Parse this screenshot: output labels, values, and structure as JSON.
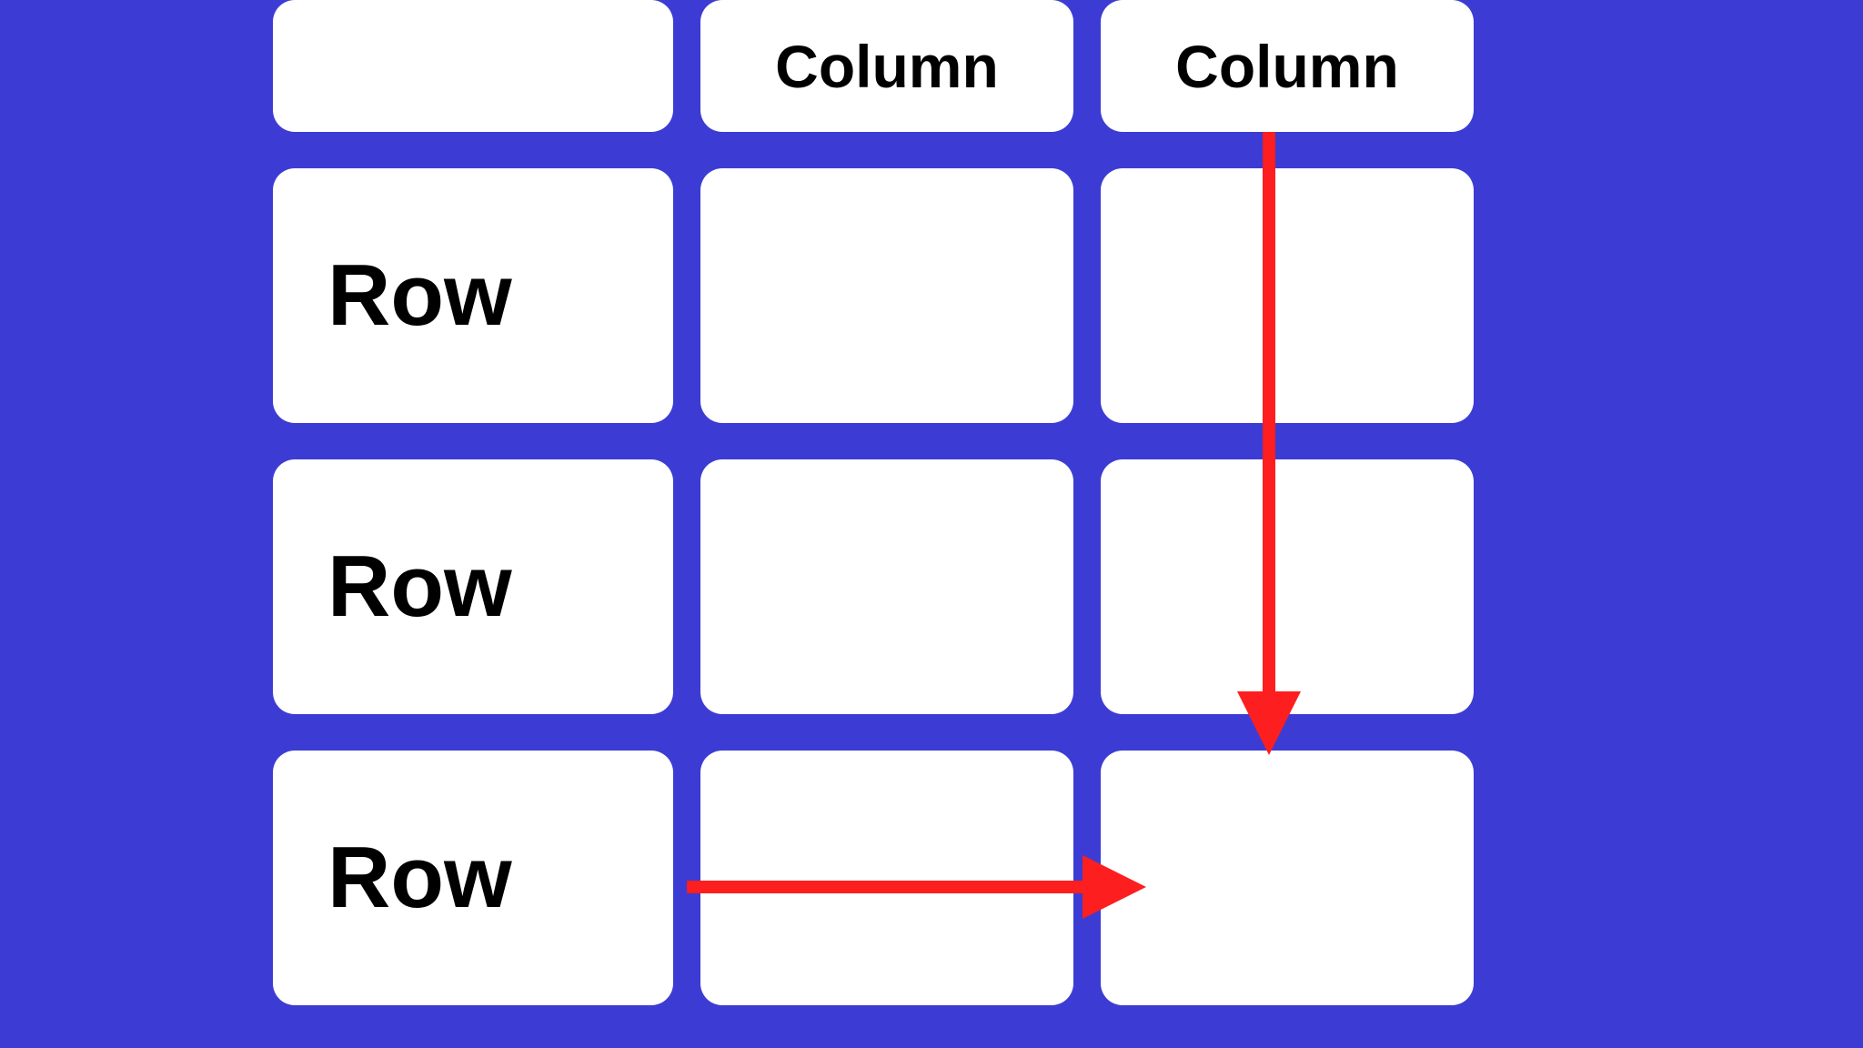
{
  "headers": {
    "col1": "",
    "col2": "Column",
    "col3": "Column"
  },
  "rows": {
    "r1": "Row",
    "r2": "Row",
    "r3": "Row"
  },
  "colors": {
    "background": "#3c3cd4",
    "cell": "#ffffff",
    "arrow": "#fd1f1f",
    "text": "#000000"
  },
  "arrows": [
    {
      "direction": "down",
      "description": "vertical arrow through column 3"
    },
    {
      "direction": "right",
      "description": "horizontal arrow through row 3"
    }
  ]
}
